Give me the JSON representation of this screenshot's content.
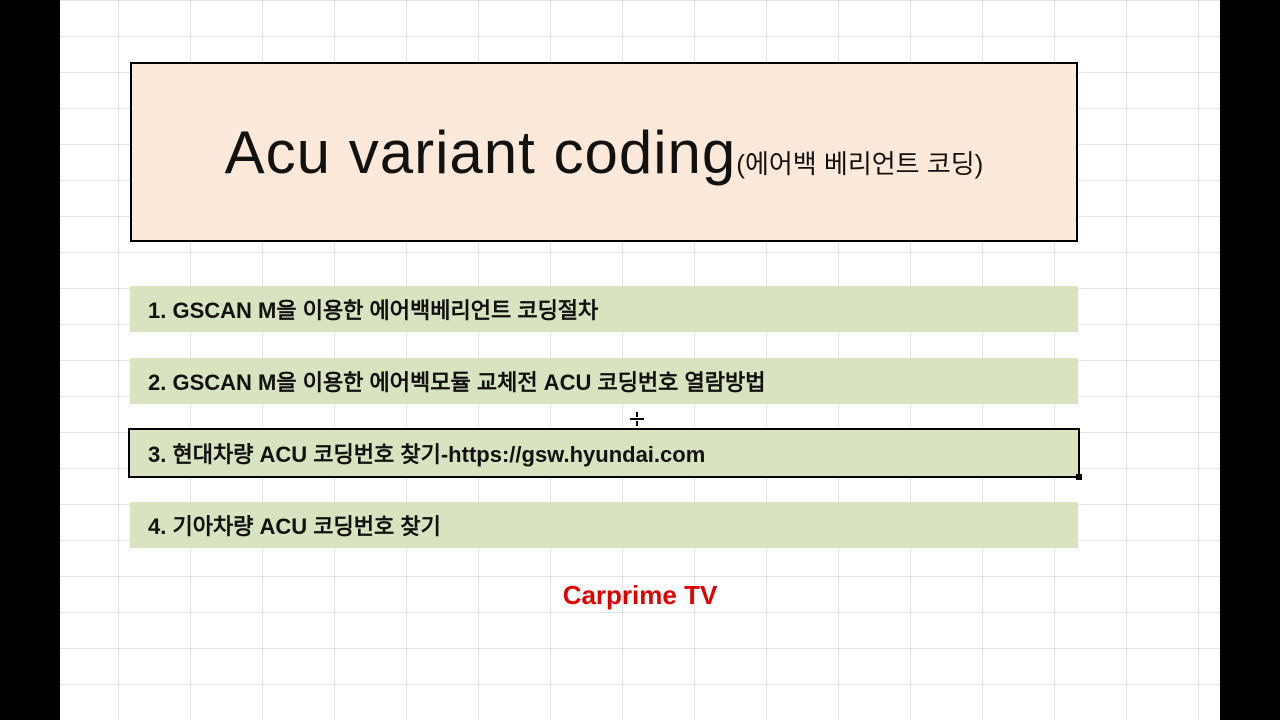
{
  "title": {
    "main": "Acu variant coding",
    "sub": "(에어백 베리언트 코딩)"
  },
  "items": [
    "1. GSCAN M을 이용한 에어백베리언트 코딩절차",
    "2. GSCAN M을 이용한 에어벡모듈 교체전 ACU 코딩번호 열람방법",
    "3. 현대차량 ACU 코딩번호 찾기-https://gsw.hyundai.com",
    "4. 기아차량 ACU 코딩번호 찾기"
  ],
  "footer": "Carprime TV"
}
